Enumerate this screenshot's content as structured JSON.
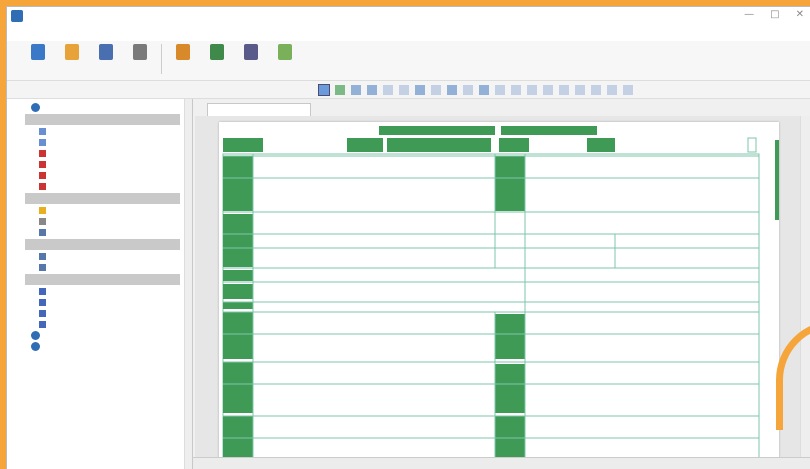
{
  "window": {
    "title": "",
    "controls": [
      "—",
      "□",
      "✕"
    ]
  },
  "menu": [],
  "toolbar": {
    "buttons": [
      {
        "label": "",
        "color": "#3a78c8"
      },
      {
        "label": "",
        "color": "#e8a23a"
      },
      {
        "label": "",
        "color": "#4a6fb0"
      },
      {
        "label": "",
        "color": "#7a7a7a"
      },
      {
        "label": "",
        "color": "#d88a2a"
      },
      {
        "label": "",
        "color": "#3f8a4a"
      },
      {
        "label": "",
        "color": "#5a5a8a"
      },
      {
        "label": "",
        "color": "#7ab05a"
      }
    ]
  },
  "zoom": {
    "label": ""
  },
  "sidebar": {
    "rows": [
      {
        "type": "root",
        "label": "",
        "icon_color": "#2f6db5"
      },
      {
        "type": "head",
        "label": ""
      },
      {
        "type": "item",
        "label": "",
        "icon_color": "#6a8fd0"
      },
      {
        "type": "item",
        "label": "",
        "icon_color": "#6a8fd0"
      },
      {
        "type": "item",
        "label": "",
        "icon_color": "#c33"
      },
      {
        "type": "item",
        "label": "",
        "icon_color": "#c33"
      },
      {
        "type": "item",
        "label": "",
        "icon_color": "#c33"
      },
      {
        "type": "item",
        "label": "",
        "icon_color": "#c33"
      },
      {
        "type": "head",
        "label": ""
      },
      {
        "type": "item",
        "label": "",
        "icon_color": "#e8b020"
      },
      {
        "type": "item",
        "label": "",
        "icon_color": "#888"
      },
      {
        "type": "item",
        "label": "",
        "icon_color": "#5577aa"
      },
      {
        "type": "head",
        "label": ""
      },
      {
        "type": "item",
        "label": "",
        "icon_color": "#5577aa"
      },
      {
        "type": "item",
        "label": "",
        "icon_color": "#5577aa"
      },
      {
        "type": "head",
        "label": ""
      },
      {
        "type": "item",
        "label": "",
        "icon_color": "#4466bb"
      },
      {
        "type": "item",
        "label": "",
        "icon_color": "#4466bb"
      },
      {
        "type": "item",
        "label": "",
        "icon_color": "#4466bb"
      },
      {
        "type": "item",
        "label": "",
        "icon_color": "#4466bb"
      },
      {
        "type": "root",
        "label": "",
        "icon_color": "#2f6db5"
      },
      {
        "type": "root",
        "label": "",
        "icon_color": "#2f6db5"
      }
    ]
  },
  "document": {
    "tab_label": "",
    "form_color": "#3f9a55",
    "form_line_color": "#7cc6a8"
  },
  "status": {
    "left": "",
    "right": ""
  }
}
